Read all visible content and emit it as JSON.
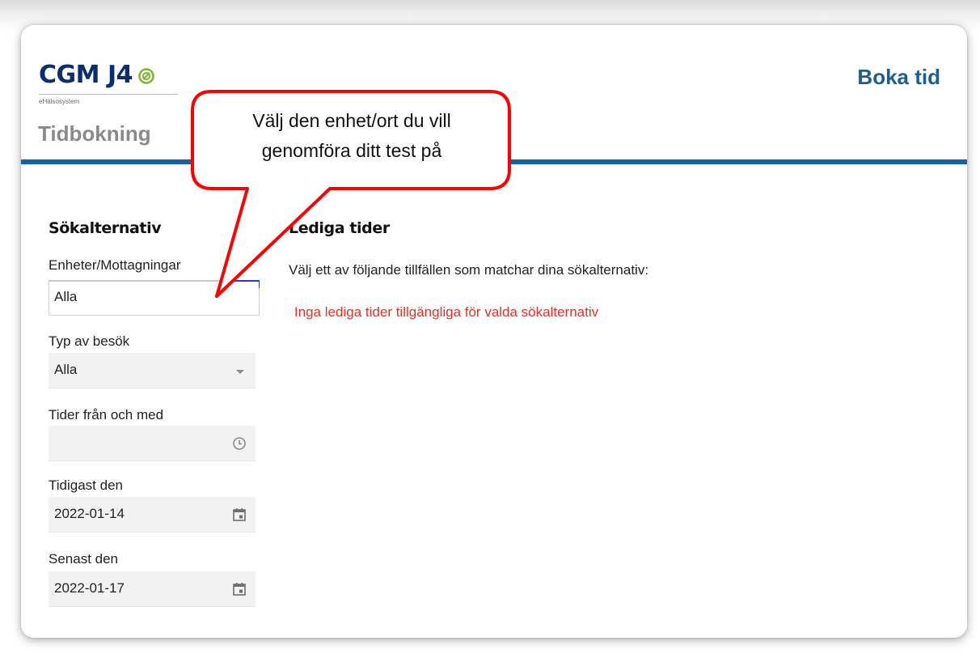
{
  "header": {
    "logo_text": "CGM J4",
    "logo_subtitle": "eHälsosystem",
    "app_title": "Tidbokning",
    "book_link": "Boka tid"
  },
  "sidebar": {
    "title": "Sökalternativ",
    "fields": {
      "units": {
        "label": "Enheter/Mottagningar",
        "value": "Alla"
      },
      "visit_type": {
        "label": "Typ av besök",
        "value": "Alla"
      },
      "time_from": {
        "label": "Tider från och med",
        "value": ""
      },
      "earliest": {
        "label": "Tidigast den",
        "value": "2022-01-14"
      },
      "latest": {
        "label": "Senast den",
        "value": "2022-01-17"
      }
    }
  },
  "main": {
    "title": "Lediga tider",
    "description": "Välj ett av följande tillfällen som matchar dina sökalternativ:",
    "empty_message": "Inga lediga tider tillgängliga för valda sökalternativ"
  },
  "callout": {
    "line1": "Välj den enhet/ort du vill",
    "line2": "genomföra ditt test på"
  },
  "colors": {
    "brand_blue": "#1a5ea5",
    "logo_navy": "#0b2f6e",
    "logo_green": "#7ab929",
    "error_red": "#e53028",
    "callout_red": "#ff0000"
  },
  "icons": {
    "logo_mark": "logo-mark-icon",
    "visit_type_dropdown": "chevron-down-icon",
    "time_from": "clock-icon",
    "earliest": "calendar-icon",
    "latest": "calendar-icon"
  }
}
